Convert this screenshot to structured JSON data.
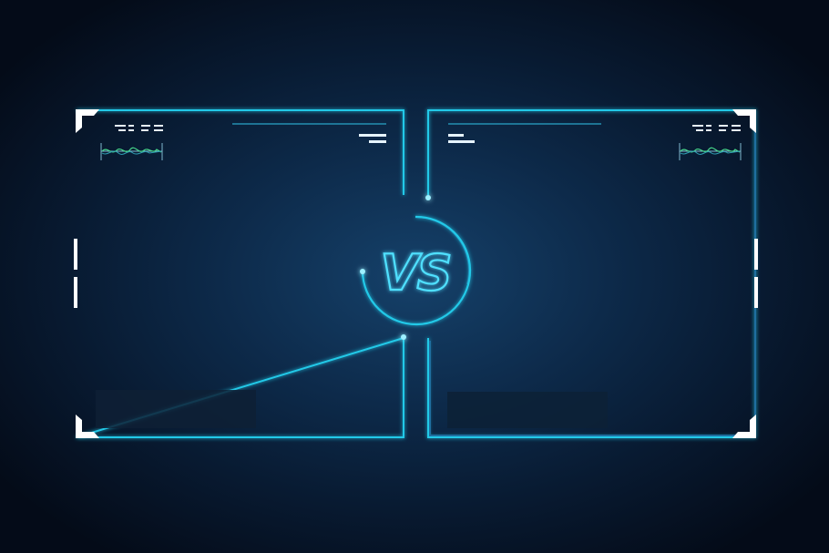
{
  "center_badge": {
    "text": "VS"
  },
  "colors": {
    "accent": "#23c9e8",
    "accent_dim": "#1f6fa0",
    "corner": "#ffffff",
    "wave": "#46d48a",
    "glow": "#67e4ff"
  },
  "players": [
    {
      "side": "left",
      "name_box_icon": "empty-name-plate"
    },
    {
      "side": "right",
      "name_box_icon": "empty-name-plate"
    }
  ]
}
